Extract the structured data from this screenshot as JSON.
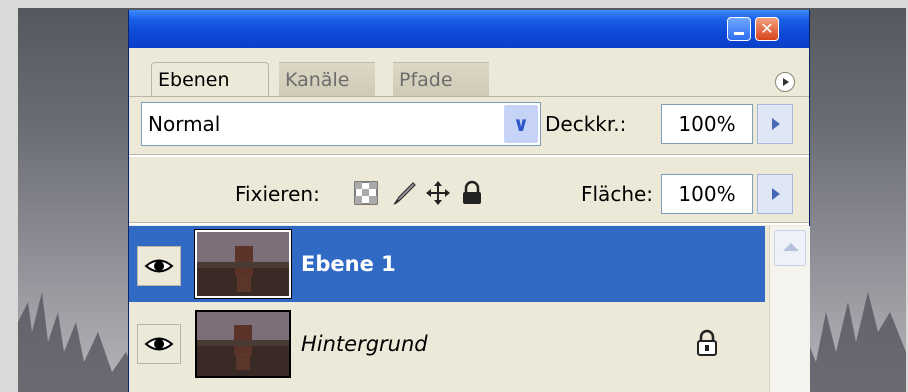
{
  "panel": {
    "tabs": [
      {
        "label": "Ebenen",
        "active": true
      },
      {
        "label": "Kanäle",
        "active": false
      },
      {
        "label": "Pfade",
        "active": false
      }
    ],
    "blend_mode": "Normal",
    "opacity_label": "Deckkr.:",
    "opacity_value": "100%",
    "lock_label": "Fixieren:",
    "fill_label": "Fläche:",
    "fill_value": "100%"
  },
  "layers": [
    {
      "name": "Ebene 1",
      "selected": true,
      "visible": true,
      "locked": false
    },
    {
      "name": "Hintergrund",
      "selected": false,
      "visible": true,
      "locked": true
    }
  ],
  "colors": {
    "selection": "#316ac5",
    "titlebar": "#0c4ad8",
    "panel_bg": "#ece9d8"
  },
  "icons": [
    "minimize-icon",
    "close-icon",
    "panel-menu-icon",
    "dropdown-arrow-icon",
    "lock-transparency-icon",
    "lock-paint-icon",
    "lock-position-icon",
    "lock-all-icon",
    "eye-icon",
    "lock-icon",
    "scroll-up-icon"
  ]
}
